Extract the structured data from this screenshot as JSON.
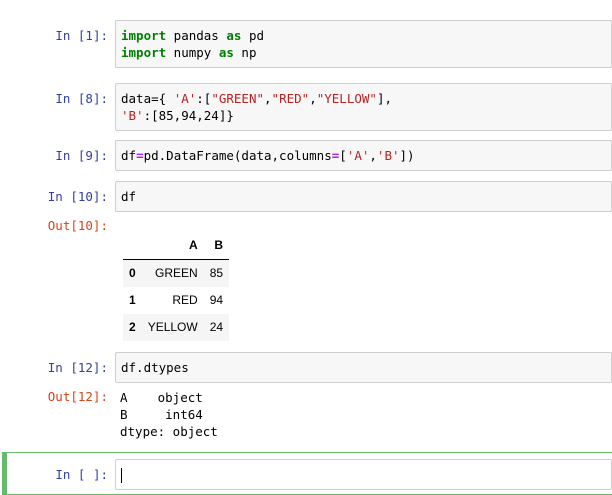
{
  "cells": [
    {
      "prompt": "In [1]:",
      "lines": [
        [
          "import",
          " pandas ",
          "as",
          " pd"
        ],
        [
          "import",
          " numpy ",
          "as",
          " np"
        ]
      ]
    },
    {
      "prompt": "In [8]:",
      "line1_a": "data={ ",
      "line1_b": "'A'",
      "line1_c": ":[",
      "line1_d": "\"GREEN\"",
      "line1_e": ",",
      "line1_f": "\"RED\"",
      "line1_g": ",",
      "line1_h": "\"YELLOW\"",
      "line1_i": "],",
      "line2_a": "'B'",
      "line2_b": ":[85,94,24]}"
    },
    {
      "prompt": "In [9]:",
      "a": "df",
      "b": "=",
      "c": "pd.DataFrame(data,columns",
      "d": "=",
      "e": "[",
      "f": "'A'",
      "g": ",",
      "h": "'B'",
      "i": "])"
    },
    {
      "prompt": "In [10]:",
      "code": "df"
    },
    {
      "prompt": "In [12]:",
      "code": "df.dtypes"
    },
    {
      "prompt": "In [ ]:",
      "code": ""
    }
  ],
  "outputs": {
    "out10_prompt": "Out[10]:",
    "out12_prompt": "Out[12]:",
    "out12_text": "A    object\nB     int64\ndtype: object"
  },
  "dataframe": {
    "columns": [
      "",
      "A",
      "B"
    ],
    "rows": [
      {
        "index": "0",
        "A": "GREEN",
        "B": "85"
      },
      {
        "index": "1",
        "A": "RED",
        "B": "94"
      },
      {
        "index": "2",
        "A": "YELLOW",
        "B": "24"
      }
    ]
  },
  "colors": {
    "in_prompt": "#303f9f",
    "out_prompt": "#d84315",
    "selected": "#66bb6a"
  }
}
